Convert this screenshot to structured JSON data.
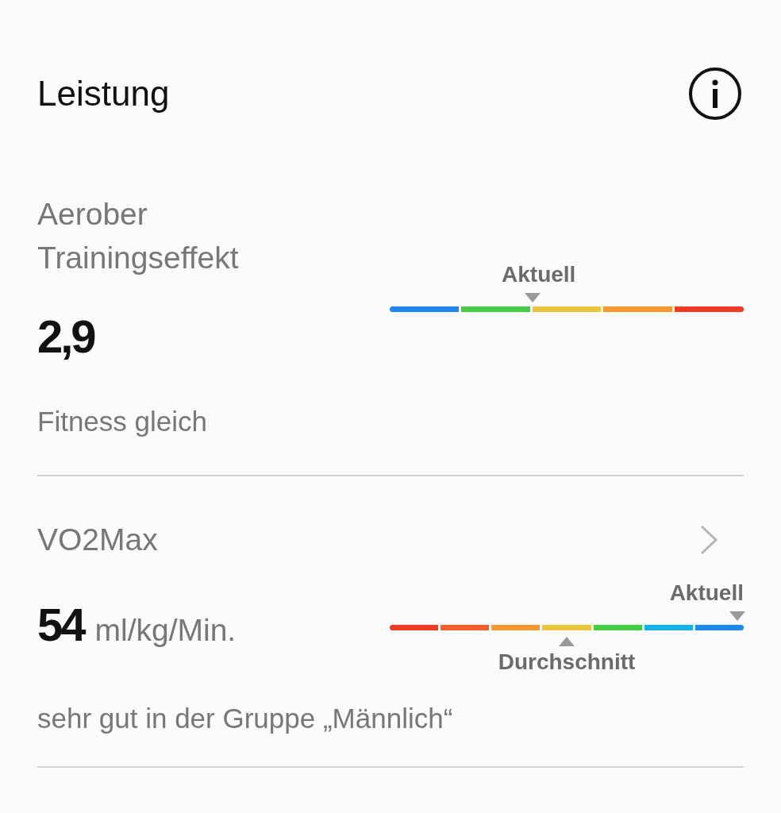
{
  "header": {
    "title": "Leistung"
  },
  "metrics": [
    {
      "kind": "static",
      "label": "Aerober Trainingseffekt",
      "value": "2,9",
      "description": "Fitness gleich",
      "scale": {
        "segments": [
          {
            "color": "#1e88f0"
          },
          {
            "color": "#44cc44"
          },
          {
            "color": "#e8c53a",
            "marker": {
              "kind": "above-start",
              "label": "Aktuell"
            }
          },
          {
            "color": "#f7982f"
          },
          {
            "color": "#f23b22"
          }
        ]
      }
    },
    {
      "kind": "link",
      "label": "VO2Max",
      "value": "54",
      "unit": "ml/kg/Min.",
      "description": "sehr gut in der Gruppe „Männlich“",
      "scale": {
        "segments": [
          {
            "color": "#f23b22"
          },
          {
            "color": "#f85e2a"
          },
          {
            "color": "#f7982f"
          },
          {
            "color": "#e8c53a",
            "marker": {
              "kind": "below-center",
              "label": "Durchschnitt"
            }
          },
          {
            "color": "#44cc44"
          },
          {
            "color": "#11b3ea"
          },
          {
            "color": "#1e88f0",
            "marker": {
              "kind": "above-end",
              "label": "Aktuell"
            }
          }
        ]
      }
    }
  ]
}
